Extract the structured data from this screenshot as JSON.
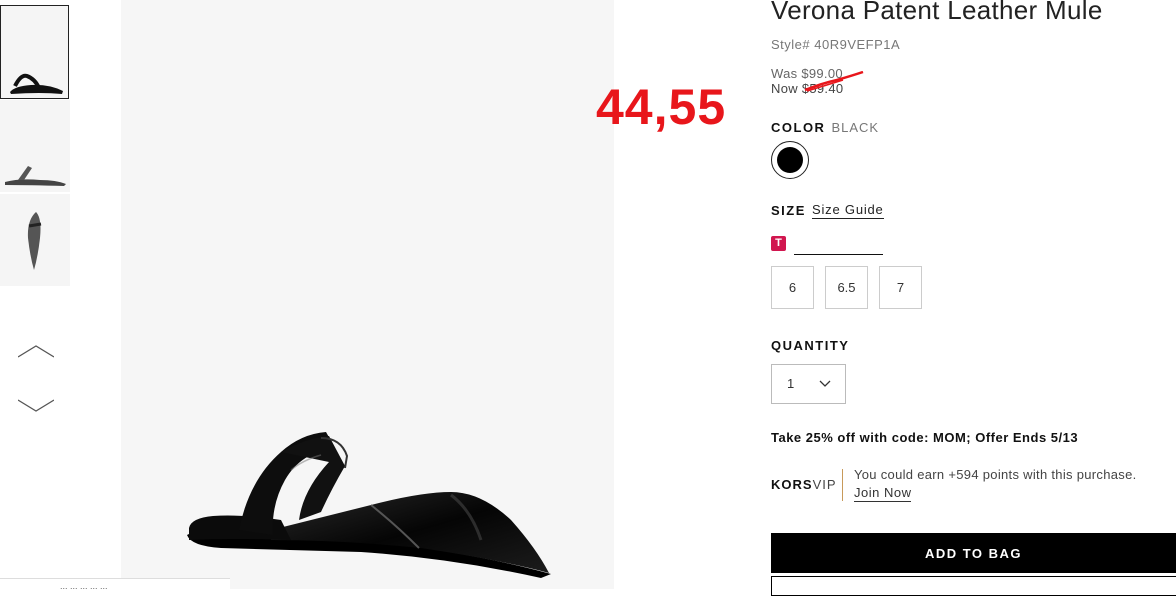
{
  "product": {
    "title": "Verona Patent Leather Mule",
    "style": "Style# 40R9VEFP1A",
    "was_price": "Was $99.00",
    "now_price": "Now $59.40",
    "annotation": "44,55",
    "annotation_color": "#e8161b"
  },
  "color": {
    "label": "COLOR",
    "value": "BLACK",
    "swatch": "#000000"
  },
  "size": {
    "label": "SIZE",
    "guide_link": "Size Guide",
    "badge": "T",
    "badge_color": "#d1164f",
    "options": [
      "6",
      "6.5",
      "7"
    ]
  },
  "quantity": {
    "label": "QUANTITY",
    "value": "1"
  },
  "promo": "Take 25% off with code: MOM; Offer Ends 5/13",
  "vip": {
    "brand_bold": "KORS",
    "brand_light": "VIP",
    "accent": "#c89a5a",
    "text": "You could earn +594 points with this purchase.",
    "link": "Join Now"
  },
  "actions": {
    "add_to_bag": "ADD TO BAG"
  },
  "footer_snippet": "... ... ... ... ..."
}
